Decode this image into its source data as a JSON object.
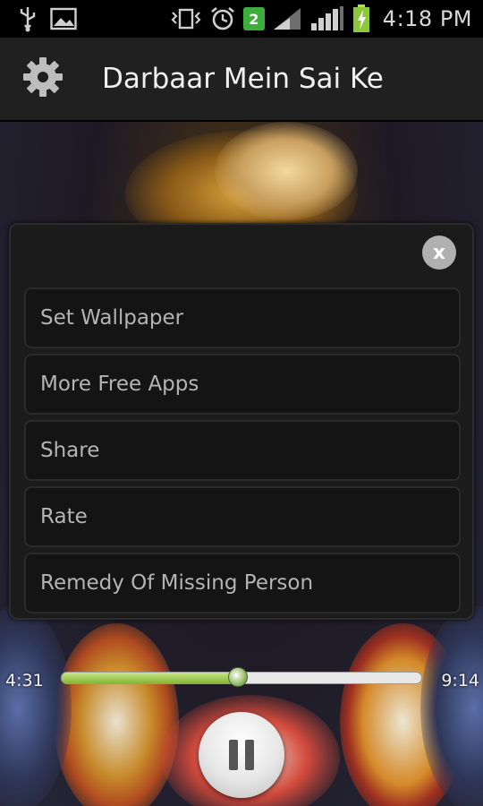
{
  "status_bar": {
    "icons_left": [
      "usb-icon",
      "image-icon"
    ],
    "icons_right": [
      "vibrate-icon",
      "alarm-icon",
      "notification-badge",
      "signal-icon",
      "signal-icon",
      "battery-charging-icon"
    ],
    "badge_count": "2",
    "time": "4:18 PM"
  },
  "title_bar": {
    "settings_icon": "gear-icon",
    "title": "Darbaar Mein Sai Ke"
  },
  "dialog": {
    "close_label": "x",
    "items": [
      {
        "label": "Set Wallpaper"
      },
      {
        "label": "More Free Apps"
      },
      {
        "label": "Share"
      },
      {
        "label": "Rate"
      },
      {
        "label": "Remedy Of Missing Person"
      }
    ]
  },
  "player": {
    "elapsed": "4:31",
    "duration": "9:14",
    "progress": 0.49,
    "pause_icon": "pause-icon"
  },
  "colors": {
    "title_bar_bg": "#202020",
    "dialog_bg": "#1b1b1b",
    "progress_fill": "#9cc84a",
    "badge_green": "#3cae3c"
  }
}
